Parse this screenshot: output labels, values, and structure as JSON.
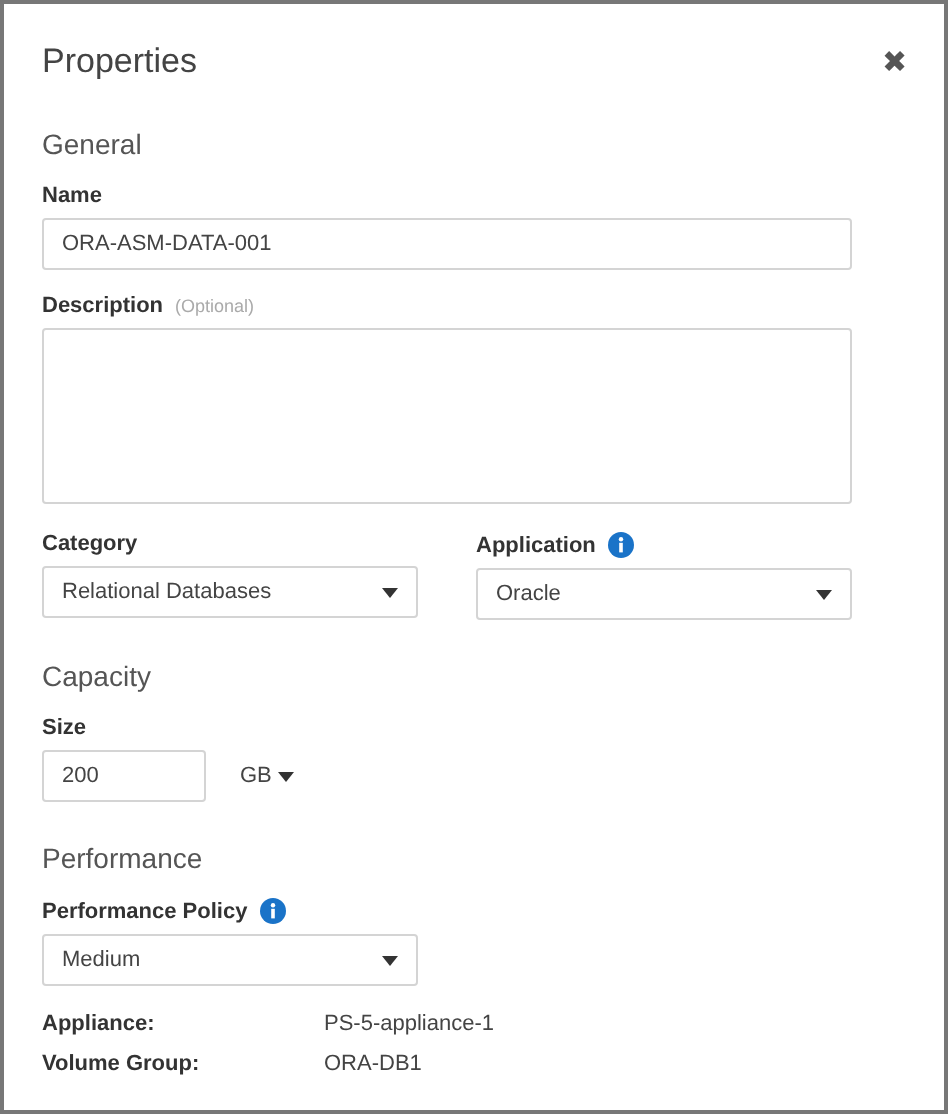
{
  "dialog": {
    "title": "Properties",
    "close": "✖"
  },
  "general": {
    "heading": "General",
    "name": {
      "label": "Name",
      "value": "ORA-ASM-DATA-001"
    },
    "description": {
      "label": "Description",
      "hint": "(Optional)"
    },
    "category": {
      "label": "Category",
      "value": "Relational Databases"
    },
    "application": {
      "label": "Application",
      "value": "Oracle",
      "info": true
    }
  },
  "capacity": {
    "heading": "Capacity",
    "size": {
      "label": "Size",
      "value": "200",
      "unit": "GB"
    }
  },
  "performance": {
    "heading": "Performance",
    "policy": {
      "label": "Performance Policy",
      "value": "Medium",
      "info": true
    },
    "details": [
      {
        "label": "Appliance:",
        "value": "PS-5-appliance-1"
      },
      {
        "label": "Volume Group:",
        "value": "ORA-DB1"
      }
    ]
  }
}
